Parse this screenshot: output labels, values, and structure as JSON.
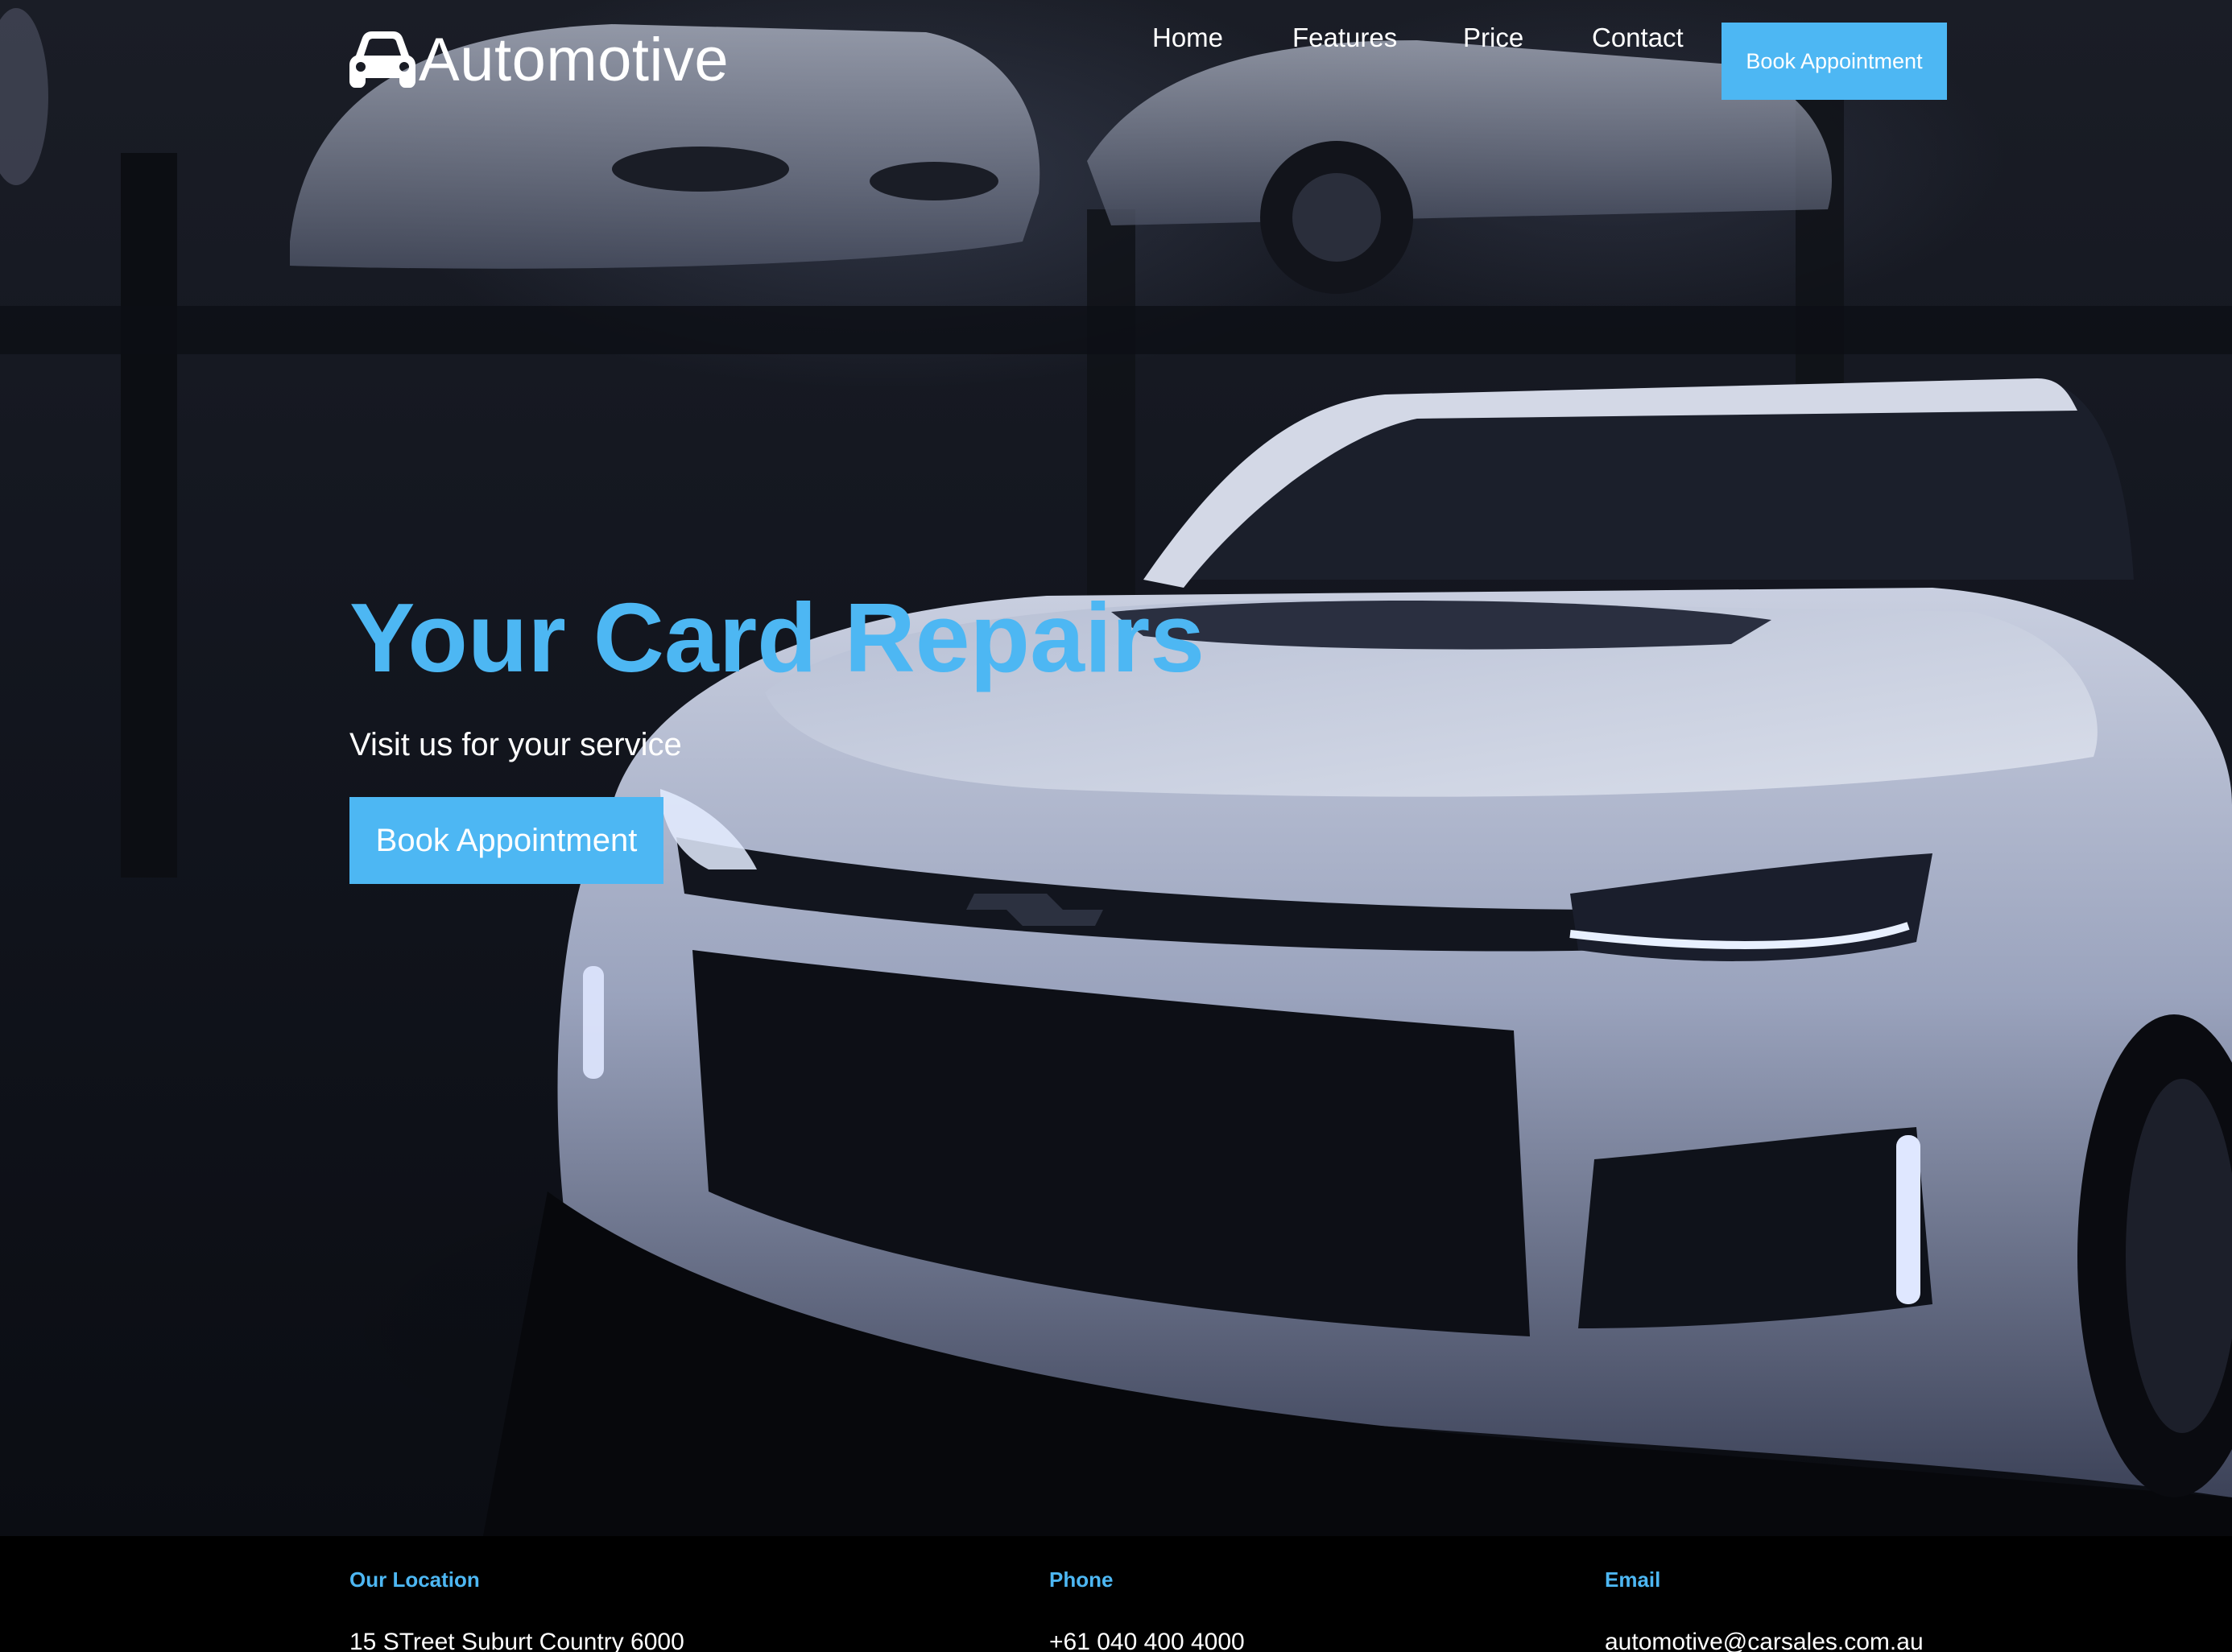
{
  "brand": {
    "name": "Automotive",
    "icon": "car-icon"
  },
  "nav": {
    "links": [
      "Home",
      "Features",
      "Price",
      "Contact"
    ],
    "cta_label": "Book Appointment"
  },
  "hero": {
    "title": "Your Card Repairs",
    "subtitle": "Visit us for your service",
    "cta_label": "Book Appointment",
    "background_image": "white sports car in a dark garage"
  },
  "info": {
    "location": {
      "label": "Our Location",
      "value": "15 STreet Suburt Country 6000"
    },
    "phone": {
      "label": "Phone",
      "value": "+61 040 400 4000"
    },
    "email": {
      "label": "Email",
      "value": "automotive@carsales.com.au"
    }
  },
  "colors": {
    "accent": "#4db7f3",
    "text": "#ffffff",
    "footer_bg": "#000000"
  }
}
